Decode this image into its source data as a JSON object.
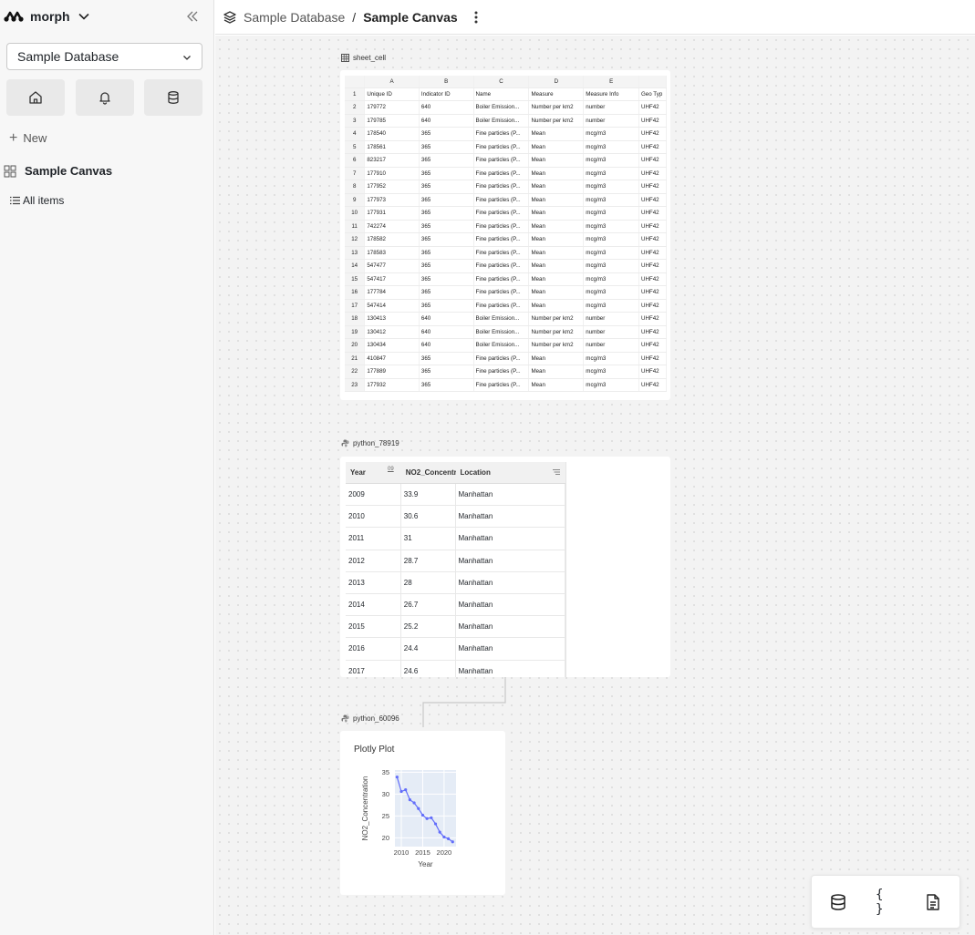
{
  "app": {
    "name": "morph"
  },
  "sidebar": {
    "database": "Sample Database",
    "new_label": "New",
    "canvas_name": "Sample Canvas",
    "all_items": "All items"
  },
  "header": {
    "breadcrumb_database": "Sample Database",
    "breadcrumb_separator": "/",
    "breadcrumb_canvas": "Sample Canvas"
  },
  "sheet_node": {
    "label": "sheet_cell",
    "columns": [
      "A",
      "B",
      "C",
      "D",
      "E",
      ""
    ],
    "headers": [
      "Unique ID",
      "Indicator ID",
      "Name",
      "Measure",
      "Measure Info",
      "Geo Typ"
    ],
    "rows": [
      [
        "179772",
        "640",
        "Boiler Emission...",
        "Number per km2",
        "number",
        "UHF42"
      ],
      [
        "179785",
        "640",
        "Boiler Emission...",
        "Number per km2",
        "number",
        "UHF42"
      ],
      [
        "178540",
        "365",
        "Fine particles (P...",
        "Mean",
        "mcg/m3",
        "UHF42"
      ],
      [
        "178561",
        "365",
        "Fine particles (P...",
        "Mean",
        "mcg/m3",
        "UHF42"
      ],
      [
        "823217",
        "365",
        "Fine particles (P...",
        "Mean",
        "mcg/m3",
        "UHF42"
      ],
      [
        "177910",
        "365",
        "Fine particles (P...",
        "Mean",
        "mcg/m3",
        "UHF42"
      ],
      [
        "177952",
        "365",
        "Fine particles (P...",
        "Mean",
        "mcg/m3",
        "UHF42"
      ],
      [
        "177973",
        "365",
        "Fine particles (P...",
        "Mean",
        "mcg/m3",
        "UHF42"
      ],
      [
        "177931",
        "365",
        "Fine particles (P...",
        "Mean",
        "mcg/m3",
        "UHF42"
      ],
      [
        "742274",
        "365",
        "Fine particles (P...",
        "Mean",
        "mcg/m3",
        "UHF42"
      ],
      [
        "178582",
        "365",
        "Fine particles (P...",
        "Mean",
        "mcg/m3",
        "UHF42"
      ],
      [
        "178583",
        "365",
        "Fine particles (P...",
        "Mean",
        "mcg/m3",
        "UHF42"
      ],
      [
        "547477",
        "365",
        "Fine particles (P...",
        "Mean",
        "mcg/m3",
        "UHF42"
      ],
      [
        "547417",
        "365",
        "Fine particles (P...",
        "Mean",
        "mcg/m3",
        "UHF42"
      ],
      [
        "177784",
        "365",
        "Fine particles (P...",
        "Mean",
        "mcg/m3",
        "UHF42"
      ],
      [
        "547414",
        "365",
        "Fine particles (P...",
        "Mean",
        "mcg/m3",
        "UHF42"
      ],
      [
        "130413",
        "640",
        "Boiler Emission...",
        "Number per km2",
        "number",
        "UHF42"
      ],
      [
        "130412",
        "640",
        "Boiler Emission...",
        "Number per km2",
        "number",
        "UHF42"
      ],
      [
        "130434",
        "640",
        "Boiler Emission...",
        "Number per km2",
        "number",
        "UHF42"
      ],
      [
        "410847",
        "365",
        "Fine particles (P...",
        "Mean",
        "mcg/m3",
        "UHF42"
      ],
      [
        "177889",
        "365",
        "Fine particles (P...",
        "Mean",
        "mcg/m3",
        "UHF42"
      ],
      [
        "177932",
        "365",
        "Fine particles (P...",
        "Mean",
        "mcg/m3",
        "UHF42"
      ]
    ]
  },
  "table_node": {
    "label": "python_78919",
    "headers": [
      "Year",
      "NO2_Concentr",
      "Location"
    ],
    "header_icon": "09",
    "rows": [
      [
        "2009",
        "33.9",
        "Manhattan"
      ],
      [
        "2010",
        "30.6",
        "Manhattan"
      ],
      [
        "2011",
        "31",
        "Manhattan"
      ],
      [
        "2012",
        "28.7",
        "Manhattan"
      ],
      [
        "2013",
        "28",
        "Manhattan"
      ],
      [
        "2014",
        "26.7",
        "Manhattan"
      ],
      [
        "2015",
        "25.2",
        "Manhattan"
      ],
      [
        "2016",
        "24.4",
        "Manhattan"
      ],
      [
        "2017",
        "24.6",
        "Manhattan"
      ]
    ]
  },
  "plot_node": {
    "label": "python_60096",
    "title": "Plotly Plot"
  },
  "chart_data": {
    "type": "line",
    "title": "Plotly Plot",
    "xlabel": "Year",
    "ylabel": "NO2_Concentration",
    "x": [
      2009,
      2010,
      2011,
      2012,
      2013,
      2014,
      2015,
      2016,
      2017,
      2018,
      2019,
      2020,
      2021,
      2022
    ],
    "y": [
      33.9,
      30.6,
      31,
      28.7,
      28,
      26.7,
      25.2,
      24.4,
      24.6,
      23.2,
      21.3,
      20.2,
      19.8,
      19.1
    ],
    "xlim": [
      2008.5,
      2022.8
    ],
    "ylim": [
      18,
      35.5
    ],
    "xticks": [
      2010,
      2015,
      2020
    ],
    "yticks": [
      20,
      25,
      30,
      35
    ],
    "grid": true,
    "color": "#636efa",
    "plot_bg": "#e5ecf6"
  },
  "toolbar": {
    "icons": [
      "database-icon",
      "code-braces-icon",
      "document-icon"
    ],
    "braces": "{ }"
  }
}
